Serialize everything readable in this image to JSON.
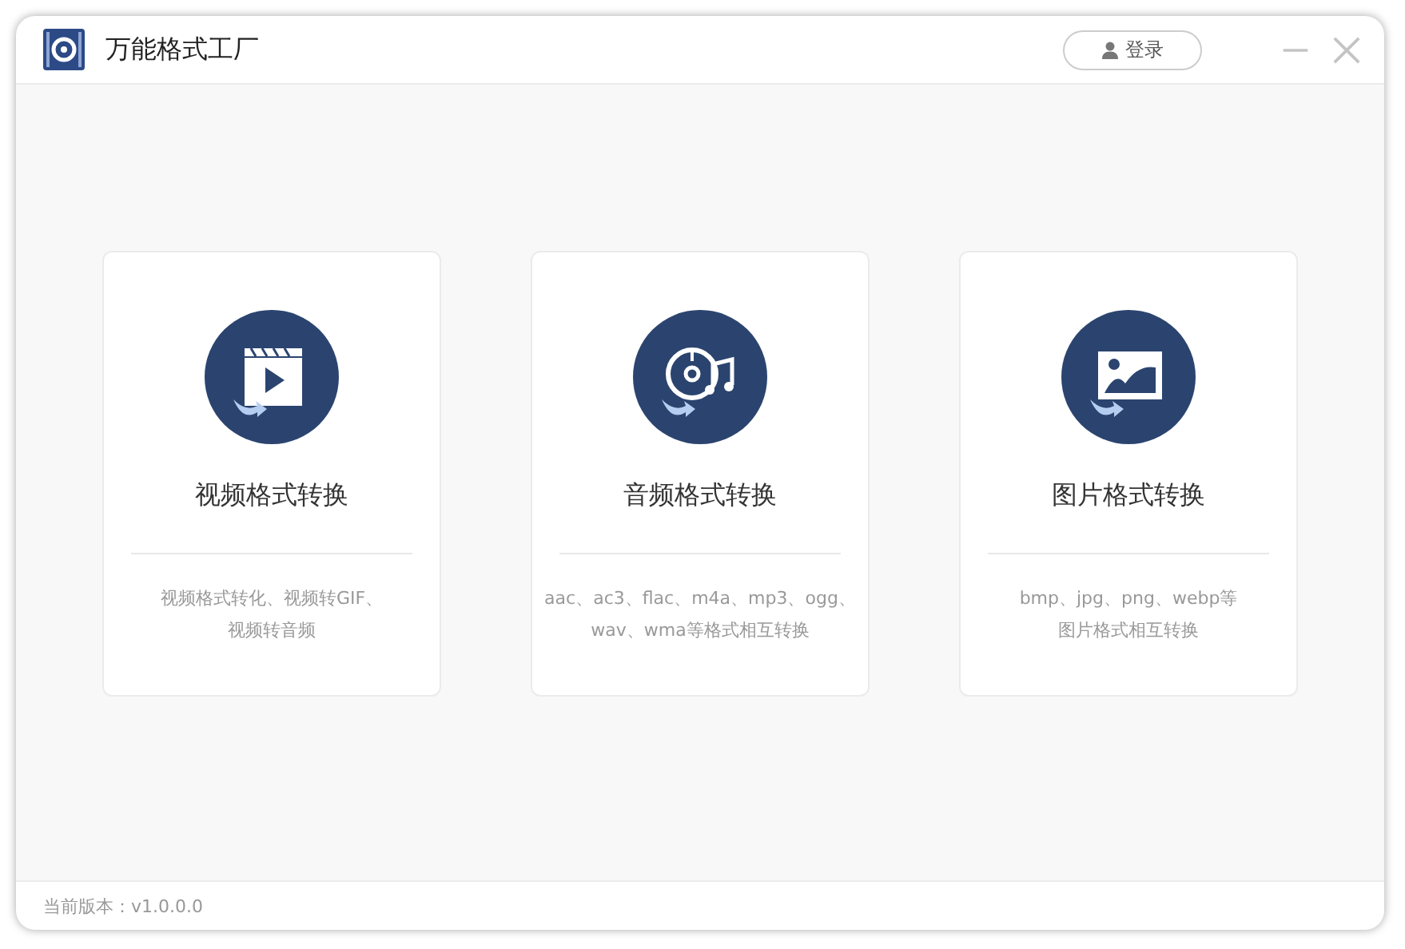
{
  "window": {
    "title": "万能格式工厂"
  },
  "login_button": {
    "label": "登录"
  },
  "cards": [
    {
      "kind": "video",
      "title": "视频格式转换",
      "description_lines": [
        "视频格式转化、视频转GIF、",
        "视频转音频"
      ]
    },
    {
      "kind": "audio",
      "title": "音频格式转换",
      "description_lines": [
        "aac、ac3、flac、m4a、mp3、ogg、",
        "wav、wma等格式相互转换"
      ]
    },
    {
      "kind": "image",
      "title": "图片格式转换",
      "description_lines": [
        "bmp、jpg、png、webp等",
        "图片格式相互转换"
      ]
    }
  ],
  "status_bar": {
    "version": "当前版本：v1.0.0.0"
  }
}
